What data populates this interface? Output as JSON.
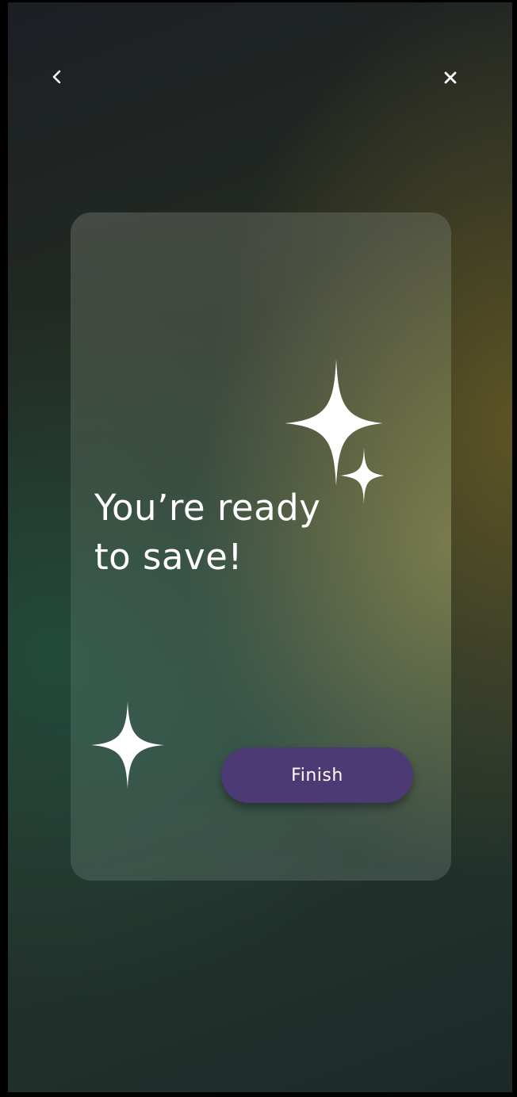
{
  "header": {
    "back_icon": "chevron-left-icon",
    "close_icon": "close-icon"
  },
  "card": {
    "headline_line1": "You’re ready",
    "headline_line2": "to save!",
    "finish_label": "Finish",
    "decor_icons": [
      "sparkle-icon",
      "sparkle-icon",
      "sparkle-icon"
    ]
  },
  "colors": {
    "button_background": "#4b3a73",
    "text": "#ffffff",
    "background_dark": "#1c1f24",
    "background_olive": "#605624",
    "background_teal": "#224e3e"
  }
}
